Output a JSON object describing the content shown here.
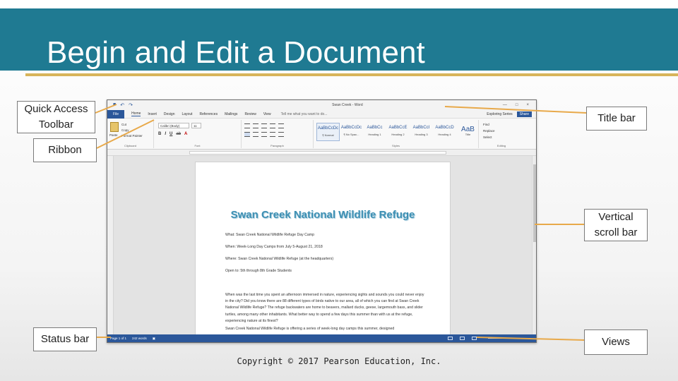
{
  "slide": {
    "title": "Begin and Edit a Document",
    "footer": "Copyright © 2017 Pearson Education, Inc."
  },
  "callouts": {
    "quick_access": "Quick Access Toolbar",
    "ribbon": "Ribbon",
    "status_bar": "Status bar",
    "title_bar": "Title bar",
    "vertical_scroll": "Vertical scroll bar",
    "views": "Views"
  },
  "colors": {
    "header_bar": "#1f7a92",
    "accent_line": "#d8b45a",
    "connector": "#e8a94a",
    "word_blue": "#2b579a"
  },
  "word": {
    "window_title": "Swan Creek - Word",
    "window_controls": [
      "—",
      "□",
      "×"
    ],
    "qat_icons": [
      "save-icon",
      "undo-icon",
      "redo-icon"
    ],
    "tabs": [
      "File",
      "Home",
      "Insert",
      "Design",
      "Layout",
      "References",
      "Mailings",
      "Review",
      "View"
    ],
    "tell_me": "Tell me what you want to do...",
    "user": "Exploring Series",
    "share": "Share",
    "ribbon": {
      "clipboard": {
        "label": "Clipboard",
        "paste": "Paste",
        "cut": "Cut",
        "copy": "Copy",
        "format_painter": "Format Painter"
      },
      "font": {
        "label": "Font",
        "font_name": "Calibri (Body)",
        "font_size": "11"
      },
      "paragraph": {
        "label": "Paragraph"
      },
      "styles": {
        "label": "Styles",
        "tiles": [
          {
            "preview": "AaBbCcDc",
            "name": "¶ Normal"
          },
          {
            "preview": "AaBbCcDc",
            "name": "¶ No Spac..."
          },
          {
            "preview": "AaBbCc",
            "name": "Heading 1"
          },
          {
            "preview": "AaBbCcE",
            "name": "Heading 2"
          },
          {
            "preview": "AaBbCcI",
            "name": "Heading 3"
          },
          {
            "preview": "AaBbCcD",
            "name": "Heading 4"
          },
          {
            "preview": "AaB",
            "name": "Title"
          }
        ]
      },
      "editing": {
        "label": "Editing",
        "find": "Find",
        "replace": "Replace",
        "select": "Select"
      }
    },
    "document": {
      "heading": "Swan Creek National Wildlife Refuge",
      "lines": [
        "What: Swan Creek National Wildlife Refuge Day Camp",
        "When: Week-Long Day Camps from July 5-August 21, 2018",
        "Where: Swan Creek National Wildlife Refuge (at the headquarters)",
        "Open to: 5th through 8th Grade Students"
      ],
      "paragraph": "When was the last time you spent an afternoon immersed in nature, experiencing sights and sounds you could never enjoy in the city? Did you know there are 88 different types of birds native to our area, all of which you can find at Swan Creek National Wildlife Refuge? The refuge backwaters are home to beavers, mallard ducks, geese, largemouth bass, and slider turtles, among many other inhabitants. What better way to spend a few days this summer than with us at the refuge, experiencing nature at its finest?",
      "paragraph2": "Swan Creek National Wildlife Refuge is offering a series of week-long day camps this summer, designed"
    },
    "status": {
      "page": "Page 1 of 1",
      "words": "242 words"
    }
  }
}
